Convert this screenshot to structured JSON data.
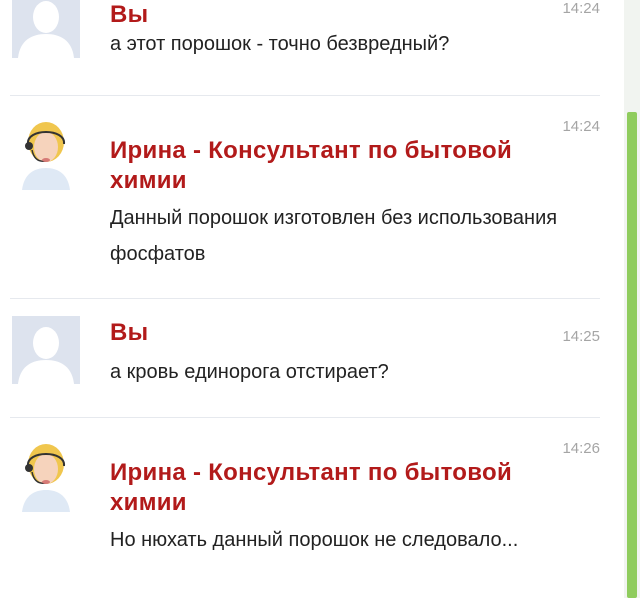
{
  "colors": {
    "author": "#b21a1a",
    "time": "#a5a5a5",
    "text": "#222222",
    "scrollbar": "#8fcc5d"
  },
  "messages": [
    {
      "author": "Вы",
      "time": "14:24",
      "text": "а этот порошок - точно безвредный?",
      "avatar": "default-user-silhouette"
    },
    {
      "author": "Ирина - Консультант по бытовой химии",
      "time": "14:24",
      "text": "Данный порошок изготовлен без использования фосфатов",
      "avatar": "consultant-headset-photo"
    },
    {
      "author": "Вы",
      "time": "14:25",
      "text": "а кровь единорога отстирает?",
      "avatar": "default-user-silhouette"
    },
    {
      "author": "Ирина - Консультант по бытовой химии",
      "time": "14:26",
      "text": "Но нюхать данный порошок не следовало...",
      "avatar": "consultant-headset-photo"
    }
  ]
}
